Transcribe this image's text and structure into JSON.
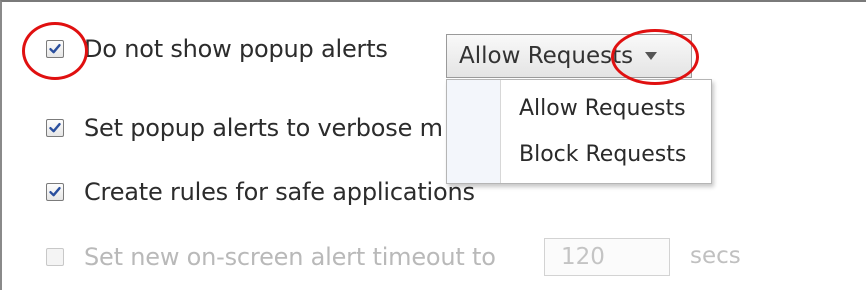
{
  "options": [
    {
      "label": "Do not show popup alerts",
      "checked": true,
      "enabled": true
    },
    {
      "label": "Set popup alerts to verbose m",
      "checked": true,
      "enabled": true
    },
    {
      "label": "Create rules for safe applications",
      "checked": true,
      "enabled": true
    },
    {
      "label": "Set new on-screen alert timeout to",
      "checked": false,
      "enabled": false
    }
  ],
  "popup_action": {
    "selected": "Allow Requests",
    "options": [
      "Allow Requests",
      "Block Requests"
    ]
  },
  "timeout": {
    "value": "120",
    "unit": "secs"
  },
  "colors": {
    "highlight": "#e01010",
    "check": "#2a4f9e"
  }
}
